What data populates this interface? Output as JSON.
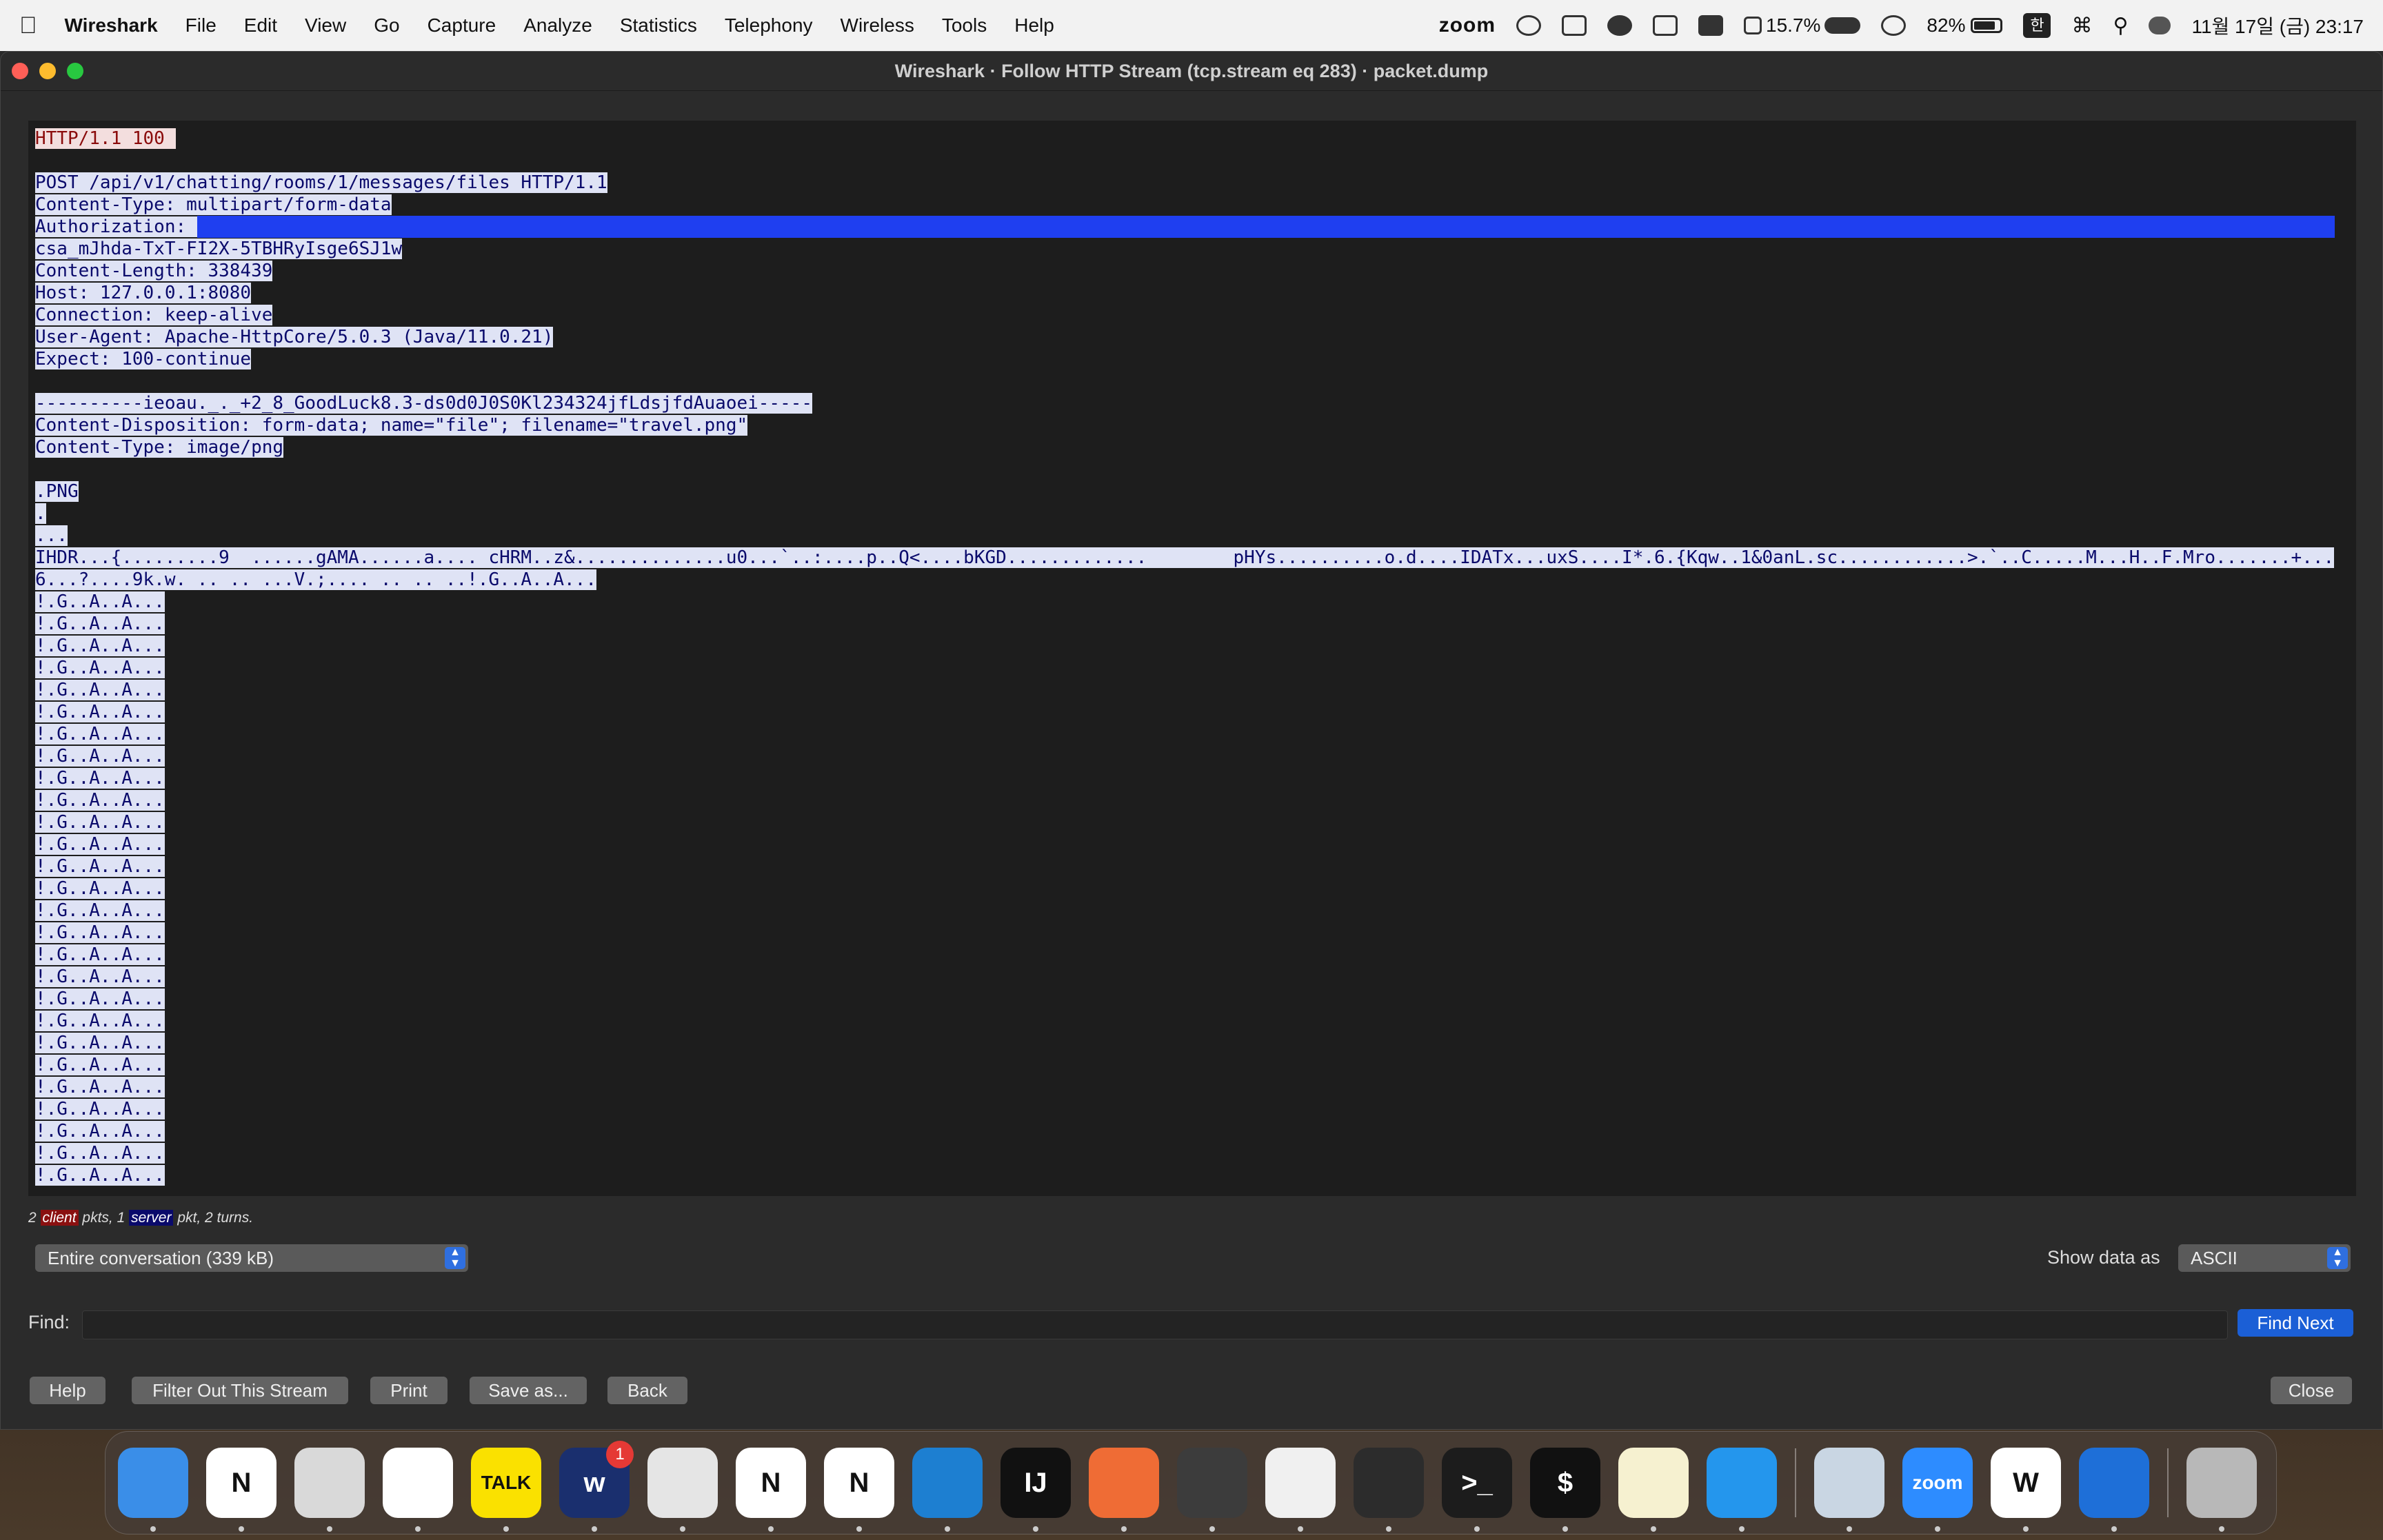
{
  "menubar": {
    "app_name": "Wireshark",
    "menus": [
      "File",
      "Edit",
      "View",
      "Go",
      "Capture",
      "Analyze",
      "Statistics",
      "Telephony",
      "Wireless",
      "Tools",
      "Help"
    ],
    "zoom_label": "zoom",
    "cpu_label": "15.7%",
    "battery_label": "82%",
    "battery_level": 0.82,
    "input_source": "한",
    "datetime": "11월 17일 (금) 23:17"
  },
  "window": {
    "title": "Wireshark · Follow HTTP Stream (tcp.stream eq 283) · packet.dump"
  },
  "stream": {
    "lines": [
      {
        "who": "server",
        "text": "HTTP/1.1 100 "
      },
      {
        "who": "blank",
        "text": ""
      },
      {
        "who": "client",
        "text": "POST /api/v1/chatting/rooms/1/messages/files HTTP/1.1"
      },
      {
        "who": "client",
        "text": "Content-Type: multipart/form-data"
      },
      {
        "who": "auth",
        "text": "Authorization: "
      },
      {
        "who": "client",
        "text": "csa_mJhda-TxT-FI2X-5TBHRyIsge6SJ1w"
      },
      {
        "who": "client",
        "text": "Content-Length: 338439"
      },
      {
        "who": "client",
        "text": "Host: 127.0.0.1:8080"
      },
      {
        "who": "client",
        "text": "Connection: keep-alive"
      },
      {
        "who": "client",
        "text": "User-Agent: Apache-HttpCore/5.0.3 (Java/11.0.21)"
      },
      {
        "who": "client",
        "text": "Expect: 100-continue"
      },
      {
        "who": "blank",
        "text": ""
      },
      {
        "who": "client",
        "text": "----------ieoau._._+2_8_GoodLuck8.3-ds0d0J0S0Kl234324jfLdsjfdAuaoei-----"
      },
      {
        "who": "client",
        "text": "Content-Disposition: form-data; name=\"file\"; filename=\"travel.png\""
      },
      {
        "who": "client",
        "text": "Content-Type: image/png"
      },
      {
        "who": "blank",
        "text": ""
      },
      {
        "who": "client",
        "text": ".PNG"
      },
      {
        "who": "client",
        "text": "."
      },
      {
        "who": "client",
        "text": "..."
      },
      {
        "who": "client",
        "text": "IHDR...{.........9  ......gAMA......a.... cHRM..z&..............u0...`..:....p..Q<....bKGD.............        pHYs..........o.d....IDATx...uxS....I*.6.{Kqw..1&0anL.sc............>.`..C.....M...H..F.Mro.......+..."
      },
      {
        "who": "client",
        "text": "6...?....9k.w. .. .. ...V.;.... .. .. ..!.G..A..A..."
      },
      {
        "who": "client",
        "text": "!.G..A..A..."
      },
      {
        "who": "client",
        "text": "!.G..A..A..."
      },
      {
        "who": "client",
        "text": "!.G..A..A..."
      },
      {
        "who": "client",
        "text": "!.G..A..A..."
      },
      {
        "who": "client",
        "text": "!.G..A..A..."
      },
      {
        "who": "client",
        "text": "!.G..A..A..."
      },
      {
        "who": "client",
        "text": "!.G..A..A..."
      },
      {
        "who": "client",
        "text": "!.G..A..A..."
      },
      {
        "who": "client",
        "text": "!.G..A..A..."
      },
      {
        "who": "client",
        "text": "!.G..A..A..."
      },
      {
        "who": "client",
        "text": "!.G..A..A..."
      },
      {
        "who": "client",
        "text": "!.G..A..A..."
      },
      {
        "who": "client",
        "text": "!.G..A..A..."
      },
      {
        "who": "client",
        "text": "!.G..A..A..."
      },
      {
        "who": "client",
        "text": "!.G..A..A..."
      },
      {
        "who": "client",
        "text": "!.G..A..A..."
      },
      {
        "who": "client",
        "text": "!.G..A..A..."
      },
      {
        "who": "client",
        "text": "!.G..A..A..."
      },
      {
        "who": "client",
        "text": "!.G..A..A..."
      },
      {
        "who": "client",
        "text": "!.G..A..A..."
      },
      {
        "who": "client",
        "text": "!.G..A..A..."
      },
      {
        "who": "client",
        "text": "!.G..A..A..."
      },
      {
        "who": "client",
        "text": "!.G..A..A..."
      },
      {
        "who": "client",
        "text": "!.G..A..A..."
      },
      {
        "who": "client",
        "text": "!.G..A..A..."
      },
      {
        "who": "client",
        "text": "!.G..A..A..."
      },
      {
        "who": "client",
        "text": "!.G..A..A..."
      }
    ]
  },
  "stats": {
    "prefix": "2",
    "client_tag": "client",
    "middle": "pkts, 1",
    "server_tag": "server",
    "suffix": "pkt, 2 turns."
  },
  "controls": {
    "conversation_select": "Entire conversation (339 kB)",
    "show_data_label": "Show data as",
    "show_data_value": "ASCII",
    "find_label": "Find:",
    "find_value": "",
    "find_next": "Find Next",
    "help": "Help",
    "filter_out": "Filter Out This Stream",
    "print": "Print",
    "save_as": "Save as...",
    "back": "Back",
    "close": "Close"
  },
  "colors": {
    "server_bg": "#f3dede",
    "server_fg": "#8a0a0a",
    "client_bg": "#dfe3f5",
    "client_fg": "#0a0a6b",
    "selection": "#1f3ff0",
    "accent": "#1b5fd6"
  },
  "dock": {
    "apps": [
      {
        "name": "finder-icon",
        "color": "#3a8ee8",
        "label": ""
      },
      {
        "name": "notion-icon",
        "color": "#ffffff",
        "label": "N"
      },
      {
        "name": "launchpad-icon",
        "color": "#d9d9d9",
        "label": ""
      },
      {
        "name": "slack-icon",
        "color": "#ffffff",
        "label": ""
      },
      {
        "name": "kakaotalk-icon",
        "color": "#fae100",
        "label": "TALK"
      },
      {
        "name": "webex-icon",
        "color": "#1a2f6e",
        "label": "w",
        "badge": "1"
      },
      {
        "name": "chrome-icon",
        "color": "#e5e5e5",
        "label": ""
      },
      {
        "name": "notion-icon",
        "color": "#ffffff",
        "label": "N"
      },
      {
        "name": "notion-icon",
        "color": "#ffffff",
        "label": "N"
      },
      {
        "name": "vscode-icon",
        "color": "#1d7fd1",
        "label": ""
      },
      {
        "name": "intellij-icon",
        "color": "#111111",
        "label": "IJ"
      },
      {
        "name": "postman-icon",
        "color": "#ef6c35",
        "label": ""
      },
      {
        "name": "affinity-icon",
        "color": "#3c3c3c",
        "label": ""
      },
      {
        "name": "mysql-workbench-icon",
        "color": "#f0f0f0",
        "label": ""
      },
      {
        "name": "figma-icon",
        "color": "#2c2c2c",
        "label": ""
      },
      {
        "name": "terminal-icon",
        "color": "#1c1c1c",
        "label": ">_"
      },
      {
        "name": "iterm-icon",
        "color": "#111111",
        "label": "$"
      },
      {
        "name": "notes-icon",
        "color": "#f6f1d0",
        "label": ""
      },
      {
        "name": "docker-icon",
        "color": "#2496ed",
        "label": ""
      },
      {
        "name": "preview-icon",
        "color": "#c9d6e3",
        "label": ""
      },
      {
        "name": "zoom-icon",
        "color": "#2d8cff",
        "label": "zoom"
      },
      {
        "name": "word-icon",
        "color": "#ffffff",
        "label": "W"
      },
      {
        "name": "wireshark-icon",
        "color": "#1e6fd8",
        "label": ""
      },
      {
        "name": "trash-icon",
        "color": "#b8b8b8",
        "label": ""
      }
    ]
  }
}
